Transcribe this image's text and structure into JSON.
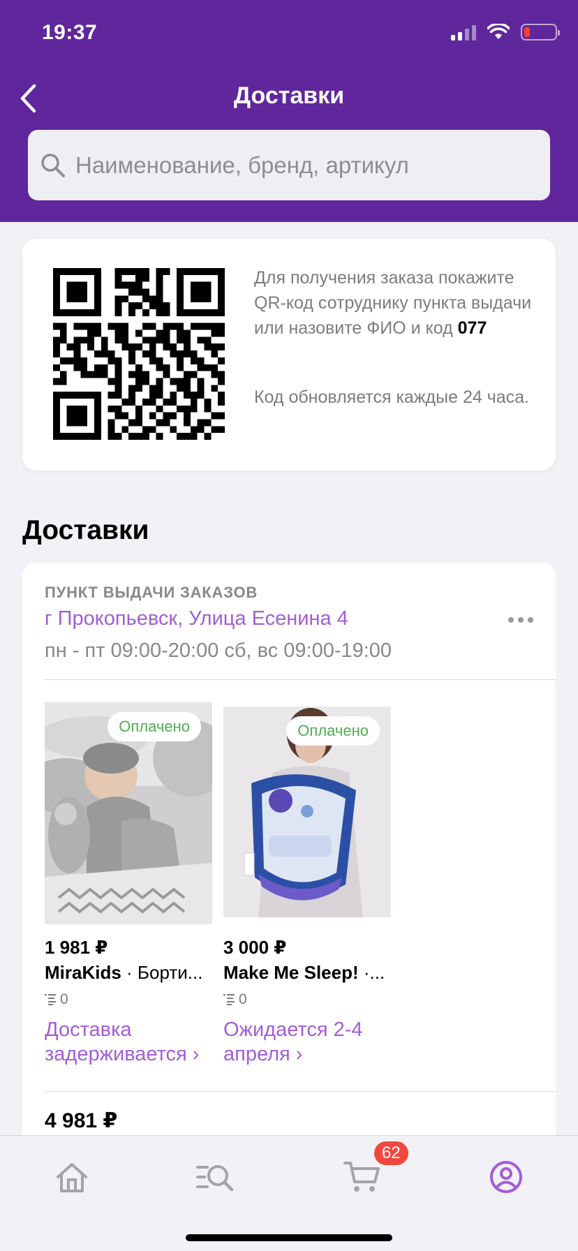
{
  "status_bar": {
    "time": "19:37"
  },
  "header": {
    "title": "Доставки"
  },
  "search": {
    "placeholder": "Наименование, бренд, артикул"
  },
  "qr_card": {
    "text_before_code": "Для получения заказа покажите QR-код сотруднику пункта выдачи или назовите ФИО и код ",
    "code": "077",
    "refresh_note": "Код обновляется каждые 24 часа."
  },
  "section_title": "Доставки",
  "pickup_point": {
    "label": "ПУНКТ ВЫДАЧИ ЗАКАЗОВ",
    "address": "г Прокопьевск, Улица Есенина 4",
    "hours": "пн - пт 09:00-20:00 сб, вс 09:00-19:00"
  },
  "products": [
    {
      "badge": "Оплачено",
      "price": "1 981 ₽",
      "brand": "MiraKids",
      "name_rest": " · Борти...",
      "reviews": "0",
      "status": "Доставка задерживается ›"
    },
    {
      "badge": "Оплачено",
      "price": "3 000 ₽",
      "brand": "Make Me Sleep!",
      "name_rest": " ·...",
      "reviews": "0",
      "status": "Ожидается 2-4 апреля ›"
    }
  ],
  "total": "4 981 ₽",
  "tabbar": {
    "tabs": [
      {
        "icon": "home-icon"
      },
      {
        "icon": "catalog-search-icon"
      },
      {
        "icon": "cart-icon"
      },
      {
        "icon": "profile-icon"
      }
    ],
    "cart_count": "62",
    "active_color": "#a35dd6"
  },
  "colors": {
    "brand": "#5f279b",
    "accent": "#a35dd6",
    "paid": "#4caf50"
  }
}
